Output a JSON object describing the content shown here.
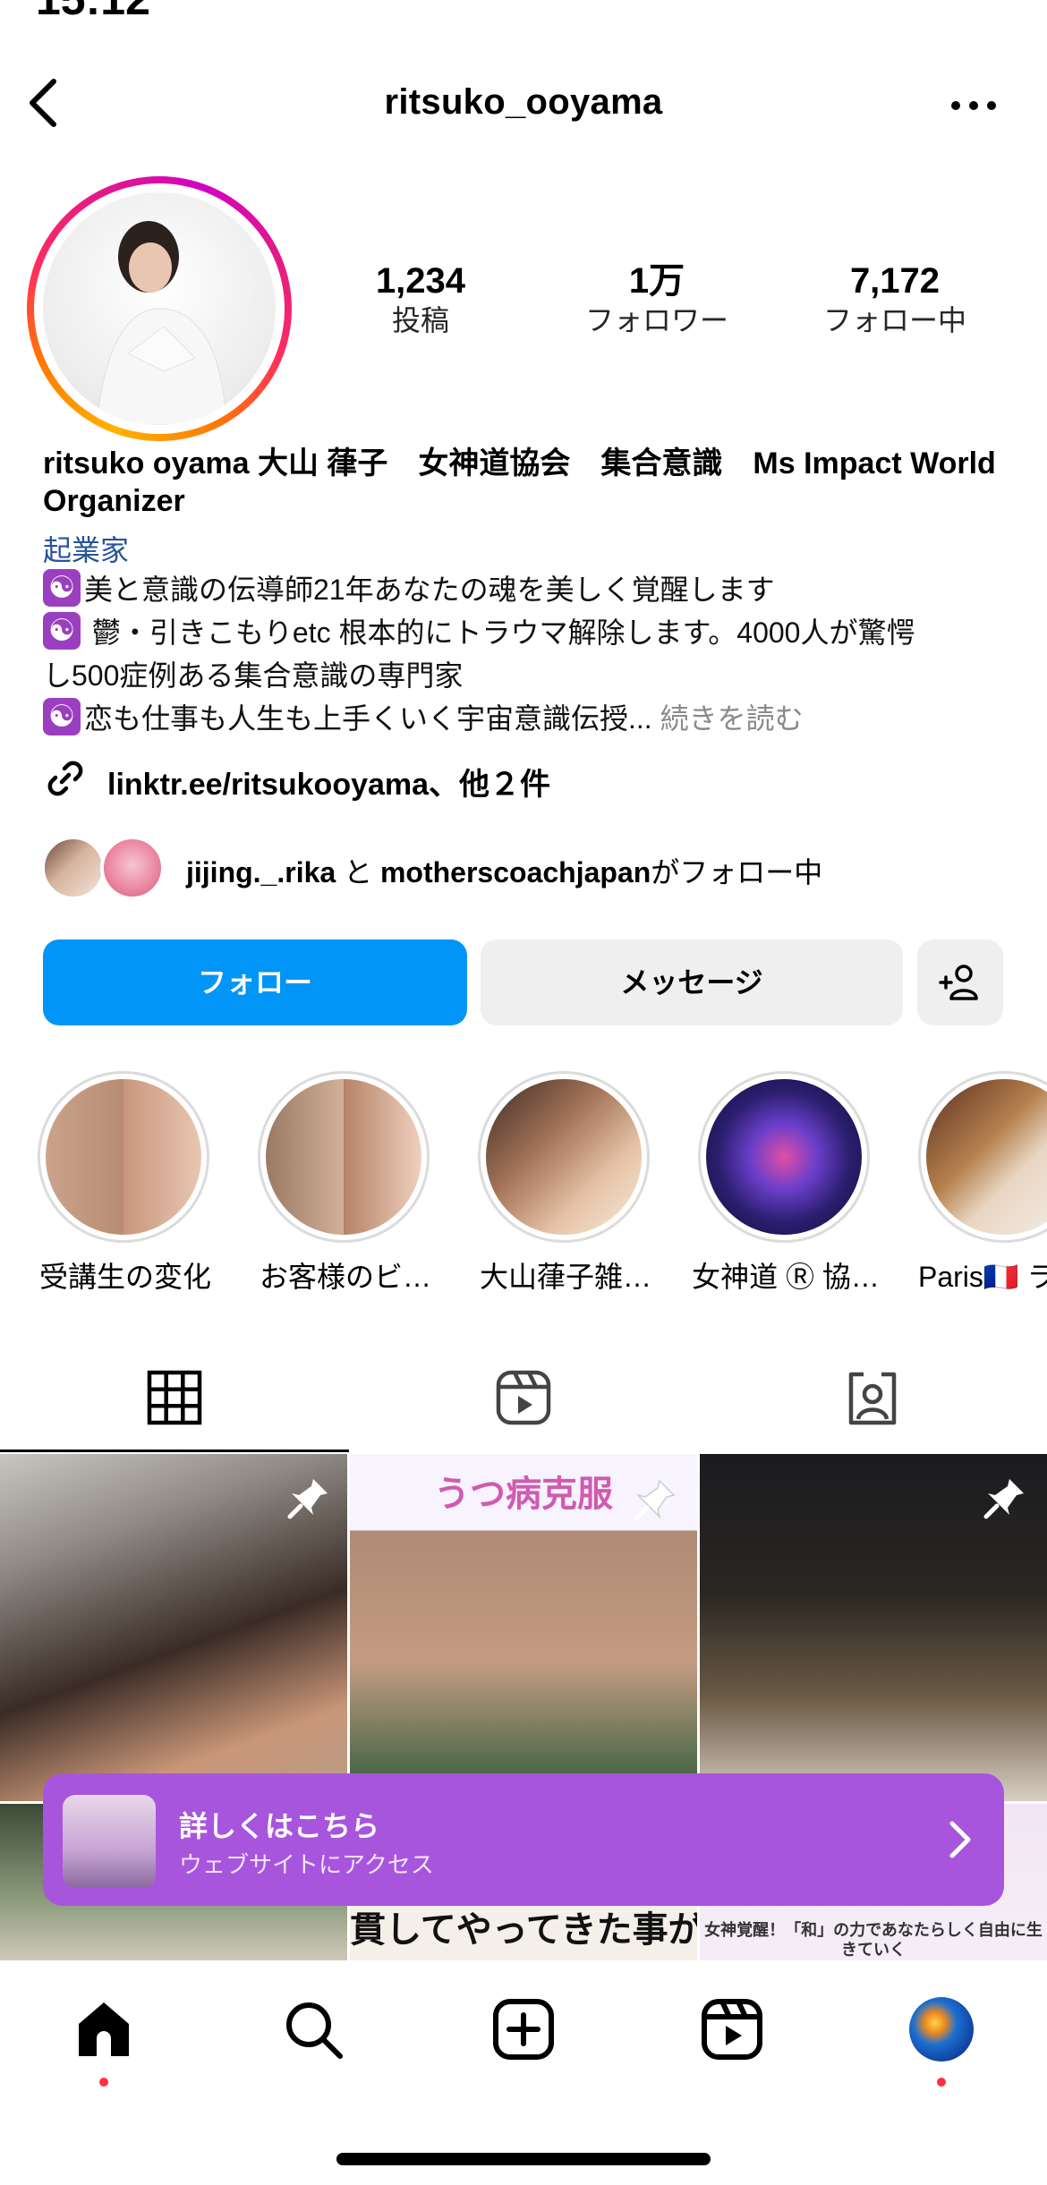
{
  "status_bar": {
    "time": "15:12"
  },
  "header": {
    "username": "ritsuko_ooyama"
  },
  "stats": [
    {
      "value": "1,234",
      "label": "投稿"
    },
    {
      "value": "1万",
      "label": "フォロワー"
    },
    {
      "value": "7,172",
      "label": "フォロー中"
    }
  ],
  "bio": {
    "display_name": "ritsuko oyama 大山 葎子　女神道協会　集合意識　Ms Impact World Organizer",
    "category": "起業家",
    "line1": "美と意識の伝導師21年あなたの魂を美しく覚醒します",
    "line2": " 鬱・引きこもりetc 根本的にトラウマ解除します。4000人が驚愕",
    "line3": "し500症例ある集合意識の専門家",
    "line4": "恋も仕事も人生も上手くいく宇宙意識伝授...",
    "more": " 続きを読む",
    "link": "linktr.ee/ritsukooyama、他２件"
  },
  "followed_by": {
    "user1": "jijing._.rika",
    "joiner": " と ",
    "user2": "motherscoachjapan",
    "suffix": "がフォロー中"
  },
  "buttons": {
    "follow": "フォロー",
    "message": "メッセージ"
  },
  "highlights": [
    {
      "label": "受講生の変化"
    },
    {
      "label": "お客様のビ…"
    },
    {
      "label": "大山葎子雑…"
    },
    {
      "label": "女神道 Ⓡ 協…"
    },
    {
      "label": "Paris🇫🇷 ラ"
    }
  ],
  "tabs": [
    "grid-tab",
    "reels-tab",
    "tagged-tab"
  ],
  "posts": {
    "post2_overlay": "うつ病克服",
    "post5_text": "貫してやってきた事が",
    "post6_text": "女神覚醒！「和」の力であなたらしく自由に生きていく"
  },
  "banner": {
    "title": "詳しくはこちら",
    "subtitle": "ウェブサイトにアクセス"
  },
  "colors": {
    "follow_button": "#0095f6",
    "banner": "#a855dd",
    "notification_dot": "#ff3040",
    "category_link": "#27549a"
  }
}
